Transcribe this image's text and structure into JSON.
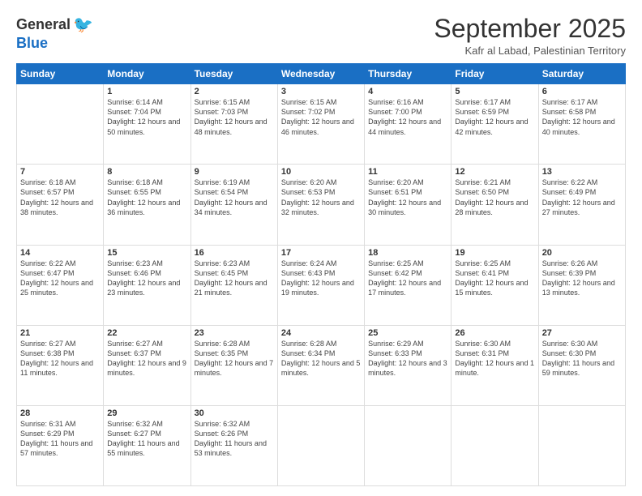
{
  "logo": {
    "general": "General",
    "blue": "Blue"
  },
  "header": {
    "month": "September 2025",
    "location": "Kafr al Labad, Palestinian Territory"
  },
  "days_of_week": [
    "Sunday",
    "Monday",
    "Tuesday",
    "Wednesday",
    "Thursday",
    "Friday",
    "Saturday"
  ],
  "weeks": [
    [
      {
        "day": null
      },
      {
        "day": 1,
        "sunrise": "6:14 AM",
        "sunset": "7:04 PM",
        "daylight": "12 hours and 50 minutes."
      },
      {
        "day": 2,
        "sunrise": "6:15 AM",
        "sunset": "7:03 PM",
        "daylight": "12 hours and 48 minutes."
      },
      {
        "day": 3,
        "sunrise": "6:15 AM",
        "sunset": "7:02 PM",
        "daylight": "12 hours and 46 minutes."
      },
      {
        "day": 4,
        "sunrise": "6:16 AM",
        "sunset": "7:00 PM",
        "daylight": "12 hours and 44 minutes."
      },
      {
        "day": 5,
        "sunrise": "6:17 AM",
        "sunset": "6:59 PM",
        "daylight": "12 hours and 42 minutes."
      },
      {
        "day": 6,
        "sunrise": "6:17 AM",
        "sunset": "6:58 PM",
        "daylight": "12 hours and 40 minutes."
      }
    ],
    [
      {
        "day": 7,
        "sunrise": "6:18 AM",
        "sunset": "6:57 PM",
        "daylight": "12 hours and 38 minutes."
      },
      {
        "day": 8,
        "sunrise": "6:18 AM",
        "sunset": "6:55 PM",
        "daylight": "12 hours and 36 minutes."
      },
      {
        "day": 9,
        "sunrise": "6:19 AM",
        "sunset": "6:54 PM",
        "daylight": "12 hours and 34 minutes."
      },
      {
        "day": 10,
        "sunrise": "6:20 AM",
        "sunset": "6:53 PM",
        "daylight": "12 hours and 32 minutes."
      },
      {
        "day": 11,
        "sunrise": "6:20 AM",
        "sunset": "6:51 PM",
        "daylight": "12 hours and 30 minutes."
      },
      {
        "day": 12,
        "sunrise": "6:21 AM",
        "sunset": "6:50 PM",
        "daylight": "12 hours and 28 minutes."
      },
      {
        "day": 13,
        "sunrise": "6:22 AM",
        "sunset": "6:49 PM",
        "daylight": "12 hours and 27 minutes."
      }
    ],
    [
      {
        "day": 14,
        "sunrise": "6:22 AM",
        "sunset": "6:47 PM",
        "daylight": "12 hours and 25 minutes."
      },
      {
        "day": 15,
        "sunrise": "6:23 AM",
        "sunset": "6:46 PM",
        "daylight": "12 hours and 23 minutes."
      },
      {
        "day": 16,
        "sunrise": "6:23 AM",
        "sunset": "6:45 PM",
        "daylight": "12 hours and 21 minutes."
      },
      {
        "day": 17,
        "sunrise": "6:24 AM",
        "sunset": "6:43 PM",
        "daylight": "12 hours and 19 minutes."
      },
      {
        "day": 18,
        "sunrise": "6:25 AM",
        "sunset": "6:42 PM",
        "daylight": "12 hours and 17 minutes."
      },
      {
        "day": 19,
        "sunrise": "6:25 AM",
        "sunset": "6:41 PM",
        "daylight": "12 hours and 15 minutes."
      },
      {
        "day": 20,
        "sunrise": "6:26 AM",
        "sunset": "6:39 PM",
        "daylight": "12 hours and 13 minutes."
      }
    ],
    [
      {
        "day": 21,
        "sunrise": "6:27 AM",
        "sunset": "6:38 PM",
        "daylight": "12 hours and 11 minutes."
      },
      {
        "day": 22,
        "sunrise": "6:27 AM",
        "sunset": "6:37 PM",
        "daylight": "12 hours and 9 minutes."
      },
      {
        "day": 23,
        "sunrise": "6:28 AM",
        "sunset": "6:35 PM",
        "daylight": "12 hours and 7 minutes."
      },
      {
        "day": 24,
        "sunrise": "6:28 AM",
        "sunset": "6:34 PM",
        "daylight": "12 hours and 5 minutes."
      },
      {
        "day": 25,
        "sunrise": "6:29 AM",
        "sunset": "6:33 PM",
        "daylight": "12 hours and 3 minutes."
      },
      {
        "day": 26,
        "sunrise": "6:30 AM",
        "sunset": "6:31 PM",
        "daylight": "12 hours and 1 minute."
      },
      {
        "day": 27,
        "sunrise": "6:30 AM",
        "sunset": "6:30 PM",
        "daylight": "11 hours and 59 minutes."
      }
    ],
    [
      {
        "day": 28,
        "sunrise": "6:31 AM",
        "sunset": "6:29 PM",
        "daylight": "11 hours and 57 minutes."
      },
      {
        "day": 29,
        "sunrise": "6:32 AM",
        "sunset": "6:27 PM",
        "daylight": "11 hours and 55 minutes."
      },
      {
        "day": 30,
        "sunrise": "6:32 AM",
        "sunset": "6:26 PM",
        "daylight": "11 hours and 53 minutes."
      },
      {
        "day": null
      },
      {
        "day": null
      },
      {
        "day": null
      },
      {
        "day": null
      }
    ]
  ]
}
